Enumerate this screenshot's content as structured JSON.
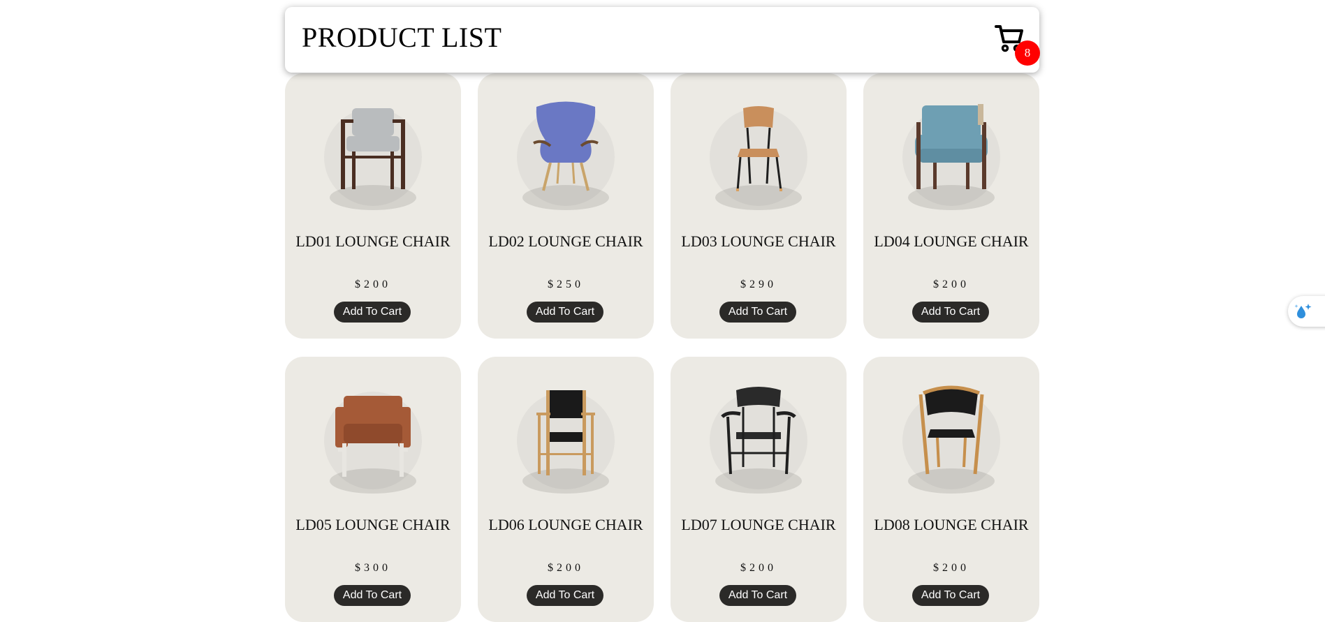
{
  "header": {
    "title": "PRODUCT LIST",
    "cart_count": "8"
  },
  "products": [
    {
      "name": "LD01 LOUNGE CHAIR",
      "price": "$200",
      "button": "Add To Cart",
      "seat": "#b9bcbe",
      "frame": "#4a2e22"
    },
    {
      "name": "LD02 LOUNGE CHAIR",
      "price": "$250",
      "button": "Add To Cart",
      "seat": "#6a78c4",
      "frame": "#c9a46a"
    },
    {
      "name": "LD03 LOUNGE CHAIR",
      "price": "$290",
      "button": "Add To Cart",
      "seat": "#c98f5c",
      "frame": "#1e1e1e"
    },
    {
      "name": "LD04 LOUNGE CHAIR",
      "price": "$200",
      "button": "Add To Cart",
      "seat": "#6e9fb3",
      "frame": "#5a3a2c"
    },
    {
      "name": "LD05 LOUNGE CHAIR",
      "price": "$300",
      "button": "Add To Cart",
      "seat": "#a55a37",
      "frame": "#e8e6e1"
    },
    {
      "name": "LD06 LOUNGE CHAIR",
      "price": "$200",
      "button": "Add To Cart",
      "seat": "#1a1a1a",
      "frame": "#c99a5e"
    },
    {
      "name": "LD07 LOUNGE CHAIR",
      "price": "$200",
      "button": "Add To Cart",
      "seat": "#2a2a2a",
      "frame": "#1f1f1f"
    },
    {
      "name": "LD08 LOUNGE CHAIR",
      "price": "$200",
      "button": "Add To Cart",
      "seat": "#1b1b1b",
      "frame": "#c68f4c"
    }
  ],
  "colors": {
    "card_bg": "#eceae4",
    "button_bg": "#2b2a28",
    "badge_bg": "#ff0000"
  },
  "icons": {
    "cart": "cart-icon",
    "side_widget": "water-drop-sparkle-icon"
  }
}
